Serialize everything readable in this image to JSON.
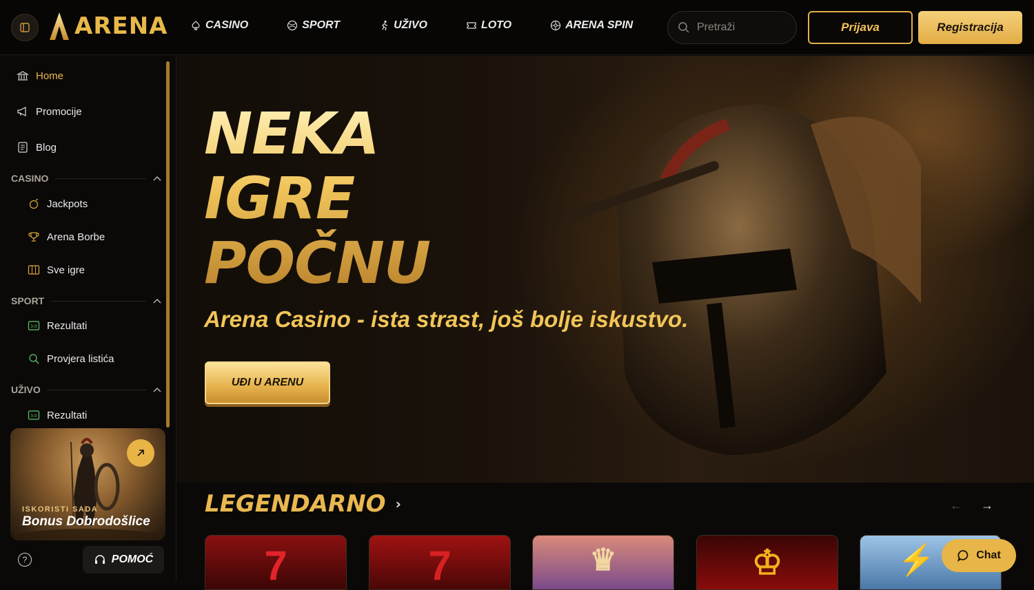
{
  "header": {
    "logo_text": "ARENA",
    "nav": [
      {
        "label": "CASINO",
        "icon": "spade-icon"
      },
      {
        "label": "SPORT",
        "icon": "ball-icon"
      },
      {
        "label": "UŽIVO",
        "icon": "runner-icon"
      },
      {
        "label": "LOTO",
        "icon": "ticket-icon"
      },
      {
        "label": "ARENA SPIN",
        "icon": "wheel-icon"
      }
    ],
    "search_placeholder": "Pretraži",
    "login_label": "Prijava",
    "register_label": "Registracija"
  },
  "sidebar": {
    "items": [
      {
        "label": "Home",
        "icon": "bank-icon",
        "active": true
      },
      {
        "label": "Promocije",
        "icon": "megaphone-icon"
      },
      {
        "label": "Blog",
        "icon": "document-icon"
      }
    ],
    "sections": [
      {
        "title": "CASINO",
        "items": [
          {
            "label": "Jackpots",
            "icon": "coin-icon"
          },
          {
            "label": "Arena Borbe",
            "icon": "trophy-icon"
          },
          {
            "label": "Sve igre",
            "icon": "slot-icon"
          }
        ]
      },
      {
        "title": "SPORT",
        "items": [
          {
            "label": "Rezultati",
            "icon": "scoreboard-icon"
          },
          {
            "label": "Provjera listića",
            "icon": "search-ticket-icon"
          }
        ]
      },
      {
        "title": "UŽIVO",
        "items": [
          {
            "label": "Rezultati",
            "icon": "scoreboard-icon"
          }
        ]
      }
    ],
    "promo": {
      "small": "ISKORISTI SADA",
      "big": "Bonus Dobrodošlice"
    },
    "help_label": "POMOĆ"
  },
  "hero": {
    "title_lines": [
      "NEKA",
      "IGRE",
      "POČNU"
    ],
    "subtitle": "Arena Casino - ista strast, još bolje iskustvo.",
    "cta": "UĐI U ARENU"
  },
  "games_section": {
    "title": "LEGENDARNO"
  },
  "chat_label": "Chat",
  "colors": {
    "accent": "#e9b64c",
    "background": "#0b0908"
  }
}
